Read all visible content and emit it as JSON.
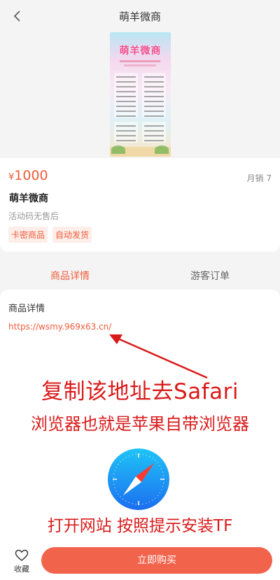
{
  "nav": {
    "title": "萌羊微商",
    "back_icon": "chevron-left-icon"
  },
  "poster": {
    "title": "萌羊微商"
  },
  "product": {
    "currency": "¥",
    "price": "1000",
    "sales": "月销 7",
    "name": "萌羊微商",
    "subtitle": "活动码无售后",
    "tags": [
      "卡密商品",
      "自动发货"
    ]
  },
  "tabs": [
    {
      "label": "商品详情",
      "active": true
    },
    {
      "label": "游客订单",
      "active": false
    }
  ],
  "detail": {
    "heading": "商品详情",
    "link": "https://wsmy.969x63.cn/",
    "line1": "复制该地址去Safari",
    "line2": "浏览器也就是苹果自带浏览器",
    "line3": "打开网站 按照提示安装TF",
    "illustration_icon": "safari-compass-icon"
  },
  "bottom": {
    "favorite_label": "收藏",
    "favorite_icon": "heart-icon",
    "buy_label": "立即购买"
  },
  "colors": {
    "accent": "#ef5b3a",
    "buy_button": "#f2634c",
    "annotation_red": "#d91b1b",
    "background": "#f4f4f4"
  }
}
